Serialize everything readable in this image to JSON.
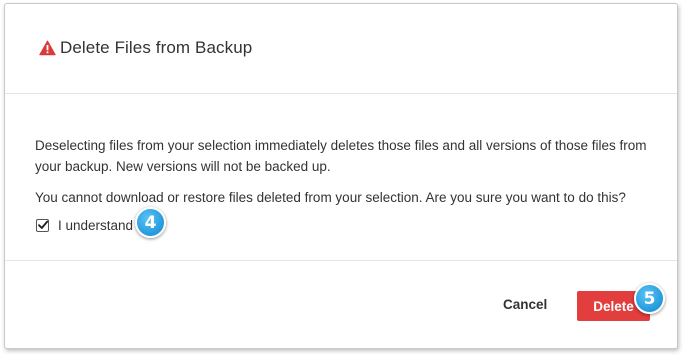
{
  "dialog": {
    "title": "Delete Files from Backup",
    "title_icon": "warning-triangle-icon",
    "warning_color": "#d93a3a",
    "paragraph1": "Deselecting files from your selection immediately deletes those files and all versions of those files from your backup. New versions will not be backed up.",
    "paragraph2": "You cannot download or restore files deleted from your selection. Are you sure you want to do this?",
    "checkbox": {
      "label": "I understand",
      "checked": true
    },
    "cancel_label": "Cancel",
    "delete_label": "Delete",
    "delete_color": "#e23e3e"
  },
  "annotations": {
    "badge_checkbox": "4",
    "badge_delete": "5",
    "badge_color": "#2a9fe0"
  }
}
